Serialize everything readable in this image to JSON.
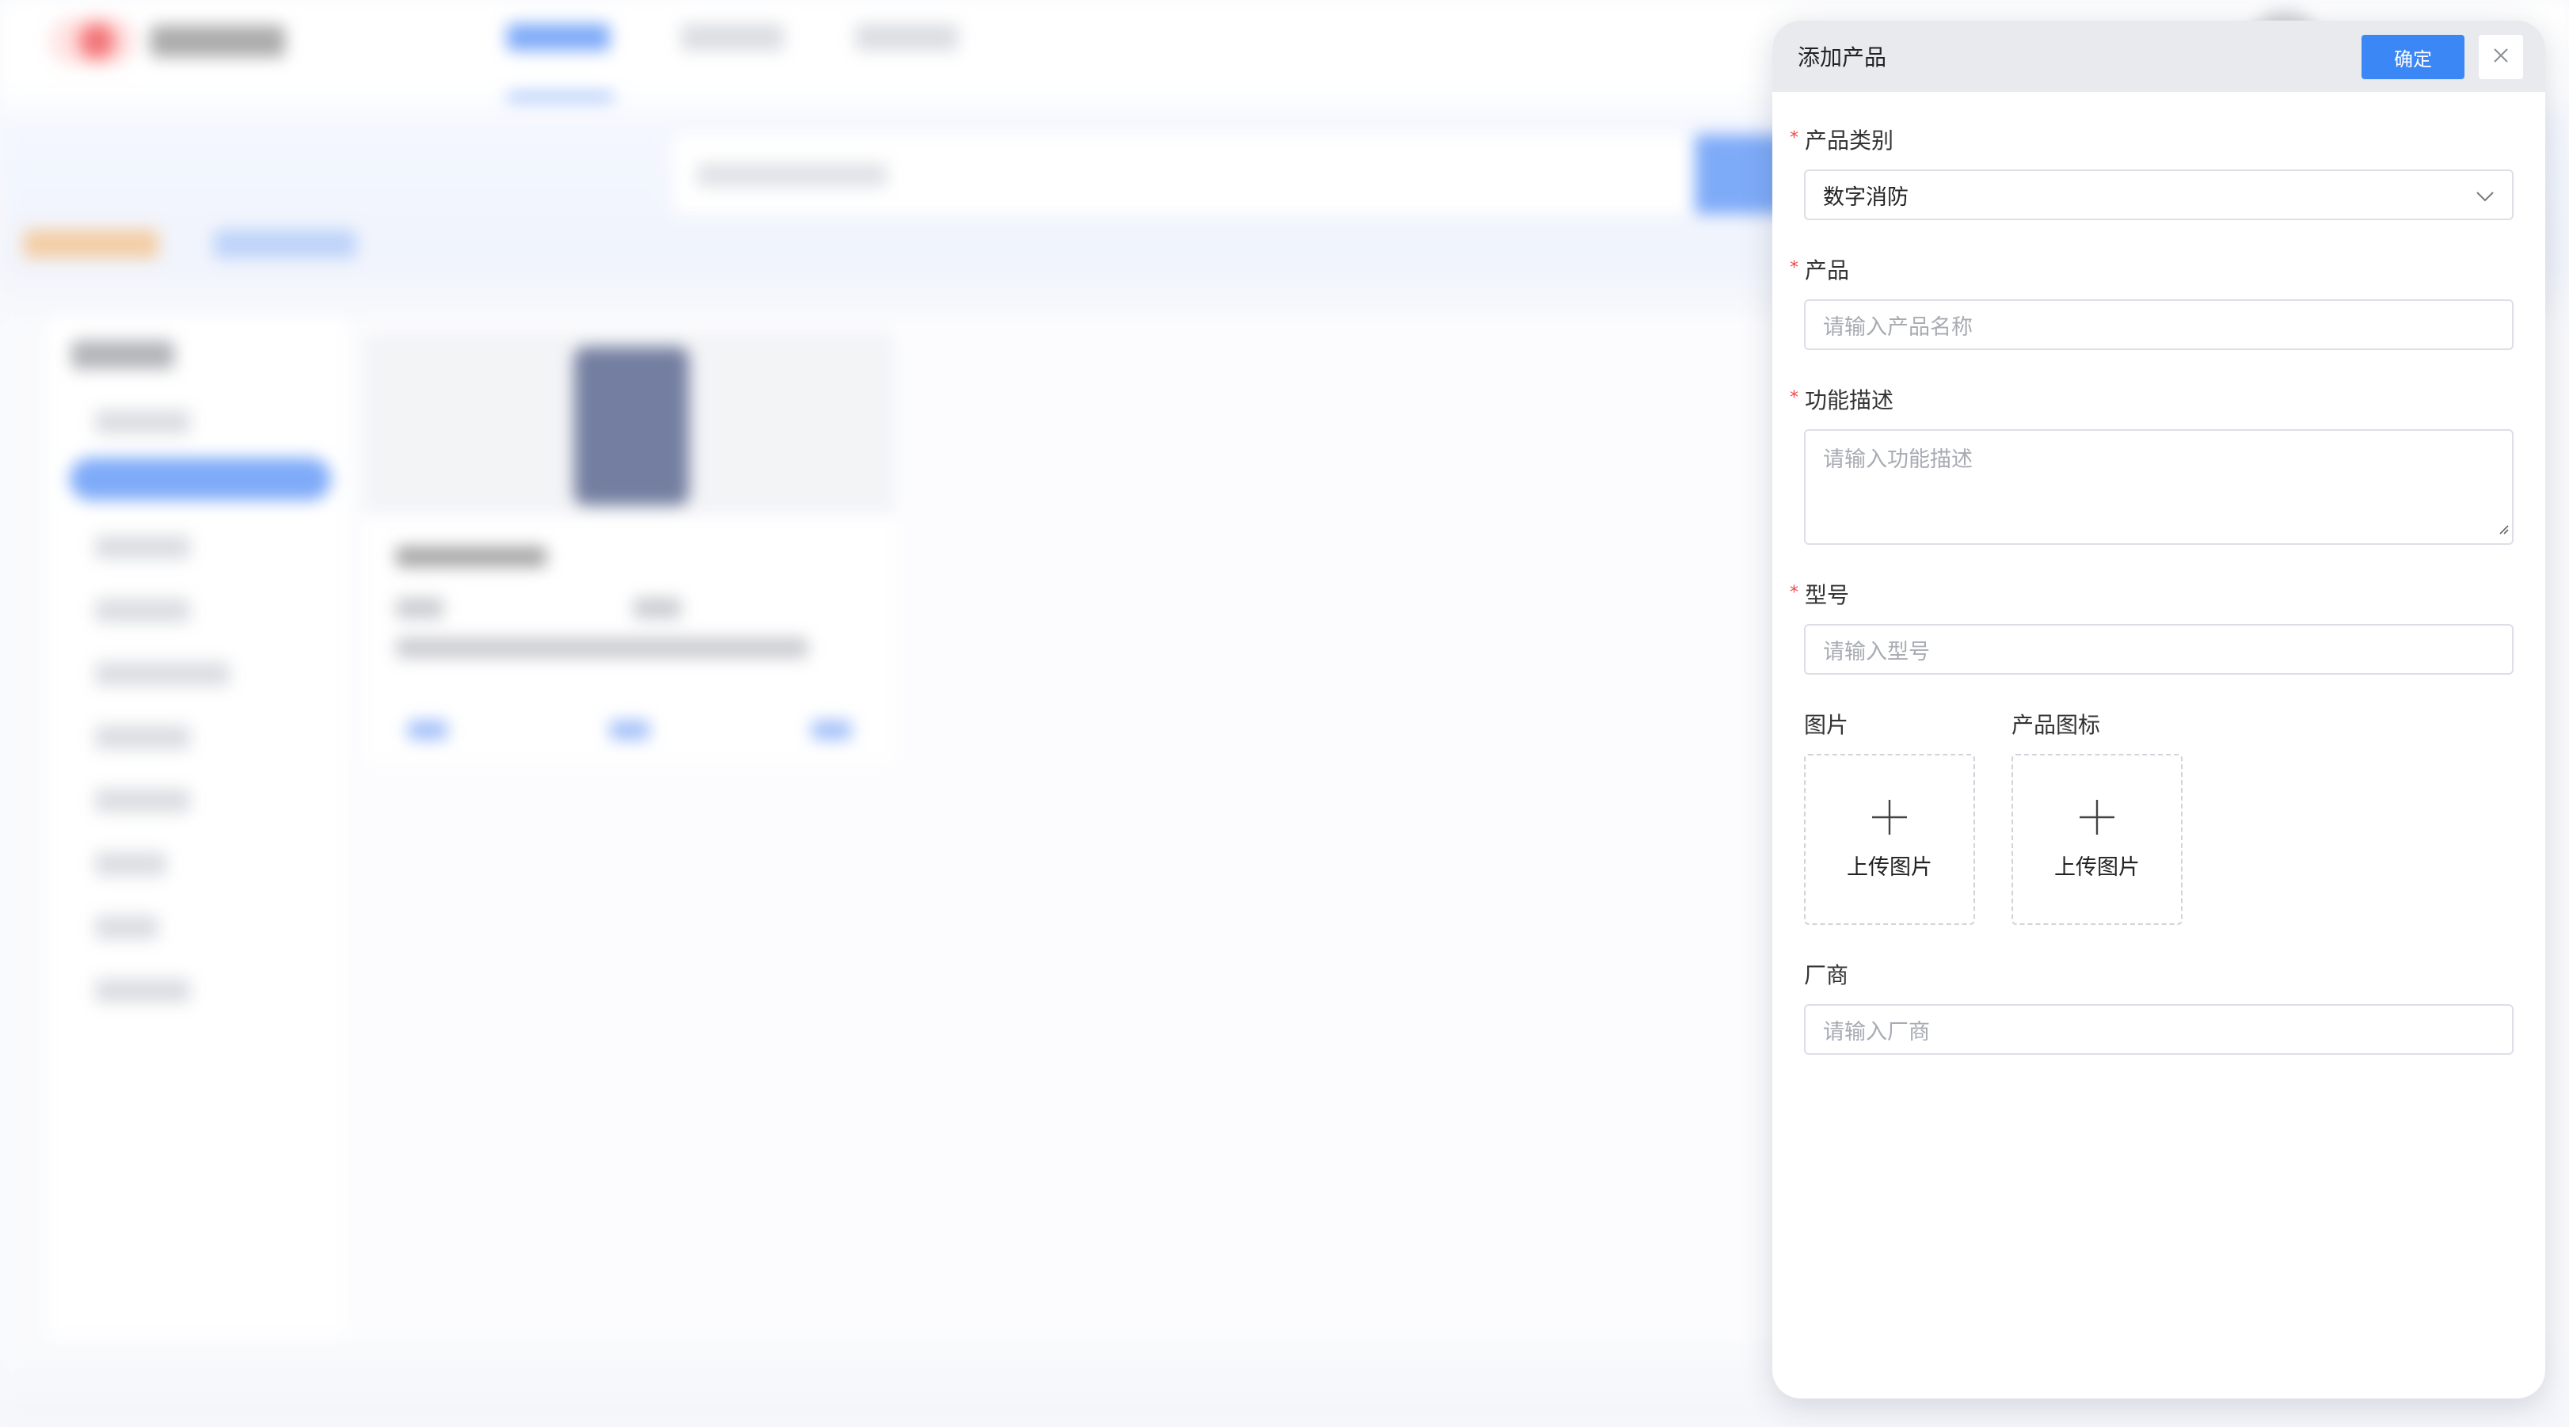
{
  "drawer": {
    "title": "添加产品",
    "confirm_label": "确定",
    "close_icon": "close-icon"
  },
  "form": {
    "category": {
      "label": "产品类别",
      "required": true,
      "value": "数字消防",
      "icon": "chevron-down-icon"
    },
    "product": {
      "label": "产品",
      "required": true,
      "placeholder": "请输入产品名称"
    },
    "description": {
      "label": "功能描述",
      "required": true,
      "placeholder": "请输入功能描述"
    },
    "model": {
      "label": "型号",
      "required": true,
      "placeholder": "请输入型号"
    },
    "image": {
      "label": "图片",
      "upload_text": "上传图片",
      "icon": "plus-icon"
    },
    "product_icon": {
      "label": "产品图标",
      "upload_text": "上传图片",
      "icon": "plus-icon"
    },
    "vendor": {
      "label": "厂商",
      "placeholder": "请输入厂商"
    }
  },
  "colors": {
    "primary": "#3b87f6",
    "required": "#f04a4a",
    "header_bg": "#e9eaee"
  }
}
